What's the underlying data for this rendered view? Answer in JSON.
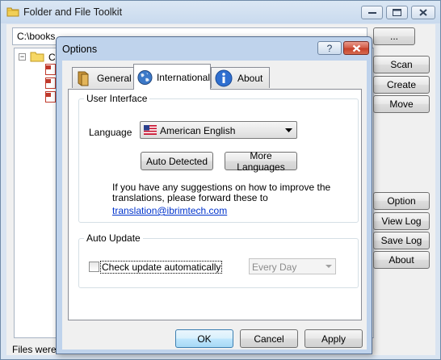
{
  "main_window": {
    "title": "Folder and File Toolkit",
    "path_value": "C:\\books",
    "browse_label": "...",
    "tree_root_label": "C:",
    "side_buttons": {
      "scan": "Scan",
      "create": "Create",
      "move": "Move",
      "option": "Option",
      "view_log": "View Log",
      "save_log": "Save Log",
      "about": "About"
    },
    "status_text": "Files were s"
  },
  "dialog": {
    "title": "Options",
    "help_label": "?",
    "tabs": {
      "general": "General",
      "international": "International",
      "about": "About"
    },
    "user_interface": {
      "legend": "User Interface",
      "language_label": "Language",
      "language_value": "American English",
      "auto_detected_label": "Auto Detected",
      "more_languages_label": "More Languages",
      "suggestion_line1": "If you have any suggestions on how to improve the",
      "suggestion_line2": "translations,  please forward these to",
      "email_link": "translation@ibrimtech.com"
    },
    "auto_update": {
      "legend": "Auto Update",
      "check_label": "Check update automatically",
      "checked": false,
      "frequency_value": "Every Day"
    },
    "footer": {
      "ok_label": "OK",
      "cancel_label": "Cancel",
      "apply_label": "Apply"
    }
  },
  "colors": {
    "link": "#0033cc",
    "close_button": "#c7412b",
    "dialog_frame": "#bfd3ec",
    "main_frame": "#d9e4f1"
  },
  "icons": {
    "app": "folder-icon",
    "tab_general": "book-icon",
    "tab_international": "globe-icon",
    "tab_about": "info-icon",
    "flag": "us-flag-icon"
  }
}
